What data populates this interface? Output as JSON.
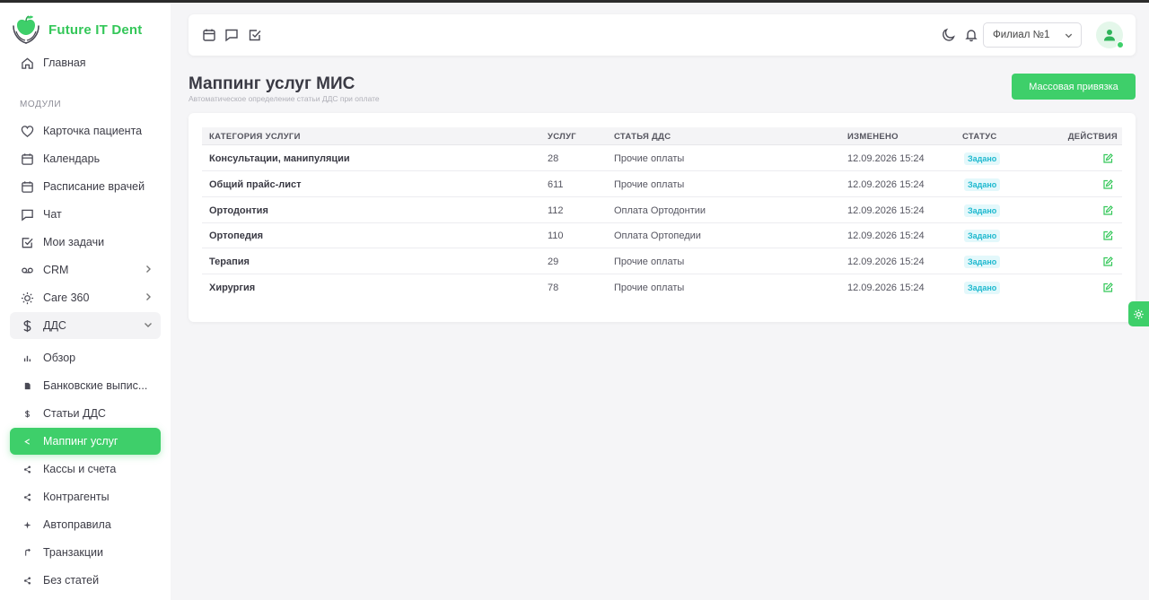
{
  "brand": {
    "name": "Future IT Dent"
  },
  "nav": {
    "home": "Главная",
    "section_label": "МОДУЛИ",
    "patient_card": "Карточка пациента",
    "calendar": "Календарь",
    "doctor_schedule": "Расписание врачей",
    "chat": "Чат",
    "tasks": "Мои задачи",
    "crm": "CRM",
    "care360": "Care 360",
    "dds": "ДДС",
    "overview": "Обзор",
    "bank_statements": "Банковские выпис...",
    "dds_items": "Статьи ДДС",
    "service_mapping": "Маппинг услуг",
    "cash_accounts": "Кассы и счета",
    "counterparties": "Контрагенты",
    "autorules": "Автоправила",
    "transactions": "Транзакции",
    "no_items": "Без статей"
  },
  "header": {
    "branch_selected": "Филиал №1"
  },
  "page": {
    "title": "Маппинг услуг МИС",
    "subtitle": "Автоматическое определение статьи ДДС при оплате",
    "bulk_button": "Массовая привязка"
  },
  "table": {
    "headers": {
      "category": "КАТЕГОРИЯ УСЛУГИ",
      "count": "УСЛУГ",
      "dds_item": "СТАТЬЯ ДДС",
      "modified": "ИЗМЕНЕНО",
      "status": "СТАТУС",
      "actions": "ДЕЙСТВИЯ"
    },
    "rows": [
      {
        "category": "Консультации, манипуляции",
        "count": "28",
        "dds_item": "Прочие оплаты",
        "modified": "12.09.2026 15:24",
        "status": "Задано"
      },
      {
        "category": "Общий прайс-лист",
        "count": "611",
        "dds_item": "Прочие оплаты",
        "modified": "12.09.2026 15:24",
        "status": "Задано"
      },
      {
        "category": "Ортодонтия",
        "count": "112",
        "dds_item": "Оплата Ортодонтии",
        "modified": "12.09.2026 15:24",
        "status": "Задано"
      },
      {
        "category": "Ортопедия",
        "count": "110",
        "dds_item": "Оплата Ортопедии",
        "modified": "12.09.2026 15:24",
        "status": "Задано"
      },
      {
        "category": "Терапия",
        "count": "29",
        "dds_item": "Прочие оплаты",
        "modified": "12.09.2026 15:24",
        "status": "Задано"
      },
      {
        "category": "Хирургия",
        "count": "78",
        "dds_item": "Прочие оплаты",
        "modified": "12.09.2026 15:24",
        "status": "Задано"
      }
    ]
  },
  "colors": {
    "accent": "#3ecf6a",
    "brand_text": "#34c759",
    "badge_bg": "#e3f8fb",
    "badge_text": "#1fb9cf"
  },
  "icons": {
    "header": [
      "calendar-icon",
      "chat-icon",
      "checkbox-icon",
      "moon-icon",
      "bell-icon",
      "user-icon"
    ],
    "floating": "gear-icon"
  }
}
